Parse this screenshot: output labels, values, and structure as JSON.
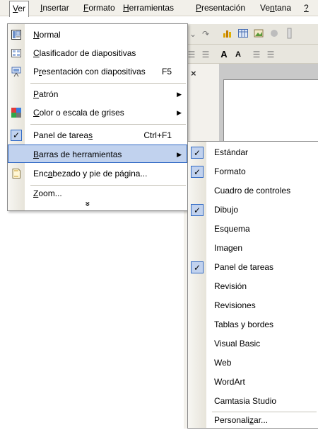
{
  "menubar": {
    "items": [
      {
        "pre": "",
        "ul": "V",
        "post": "er"
      },
      {
        "pre": "",
        "ul": "I",
        "post": "nsertar"
      },
      {
        "pre": "",
        "ul": "F",
        "post": "ormato"
      },
      {
        "pre": "",
        "ul": "H",
        "post": "erramientas"
      },
      {
        "pre": "",
        "ul": "P",
        "post": "resentación"
      },
      {
        "pre": "Ve",
        "ul": "n",
        "post": "tana"
      },
      {
        "pre": "",
        "ul": "?",
        "post": ""
      }
    ]
  },
  "toolbar": {
    "close_label": "×",
    "font_size_up": "A",
    "font_size_down": "A"
  },
  "menu": {
    "items": [
      {
        "pre": "",
        "ul": "N",
        "post": "ormal",
        "icon": "normal-view-icon"
      },
      {
        "pre": "",
        "ul": "C",
        "post": "lasificador de diapositivas",
        "icon": "slide-sorter-icon"
      },
      {
        "pre": "P",
        "ul": "r",
        "post": "esentación con diapositivas",
        "shortcut": "F5",
        "icon": "slideshow-icon"
      },
      {
        "pre": "",
        "ul": "P",
        "post": "atrón"
      },
      {
        "pre": "",
        "ul": "C",
        "post": "olor o escala de grises",
        "icon": "color-grayscale-icon"
      },
      {
        "pre": "Panel de tarea",
        "ul": "s",
        "post": "",
        "shortcut": "Ctrl+F1",
        "check": "✓"
      },
      {
        "pre": "",
        "ul": "B",
        "post": "arras de herramientas"
      },
      {
        "pre": "Enc",
        "ul": "a",
        "post": "bezado y pie de página...",
        "icon": "header-footer-icon"
      },
      {
        "pre": "",
        "ul": "Z",
        "post": "oom..."
      }
    ],
    "expand_label": "»"
  },
  "submenu": {
    "items": [
      {
        "label": "Estándar",
        "checked": "✓"
      },
      {
        "label": "Formato",
        "checked": "✓"
      },
      {
        "label": "Cuadro de controles",
        "checked": ""
      },
      {
        "label": "Dibujo",
        "checked": "✓"
      },
      {
        "label": "Esquema",
        "checked": ""
      },
      {
        "label": "Imagen",
        "checked": ""
      },
      {
        "label": "Panel de tareas",
        "checked": "✓"
      },
      {
        "label": "Revisión",
        "checked": ""
      },
      {
        "label": "Revisiones",
        "checked": ""
      },
      {
        "label": "Tablas y bordes",
        "checked": ""
      },
      {
        "label": "Visual Basic",
        "checked": ""
      },
      {
        "label": "Web",
        "checked": ""
      },
      {
        "label": "WordArt",
        "checked": ""
      },
      {
        "label": "Camtasia Studio",
        "checked": ""
      }
    ],
    "customize": {
      "pre": "Personali",
      "ul": "z",
      "post": "ar..."
    }
  },
  "colors": {
    "menu_highlight": "#c1d2ee",
    "menu_highlight_border": "#316ac5",
    "menubar_bg": "#f2f0ea"
  }
}
